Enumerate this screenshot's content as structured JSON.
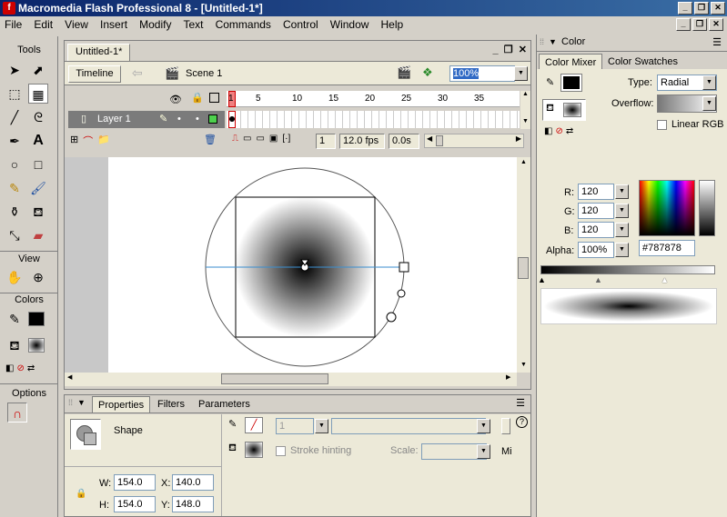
{
  "window": {
    "title": "Macromedia Flash Professional 8 - [Untitled-1*]"
  },
  "menu": [
    "File",
    "Edit",
    "View",
    "Insert",
    "Modify",
    "Text",
    "Commands",
    "Control",
    "Window",
    "Help"
  ],
  "tools": {
    "title": "Tools",
    "view_label": "View",
    "colors_label": "Colors",
    "options_label": "Options"
  },
  "document": {
    "tab": "Untitled-1*",
    "timeline_button": "Timeline",
    "scene": "Scene 1",
    "zoom": "100%"
  },
  "timeline": {
    "layer_name": "Layer 1",
    "frame_numbers": [
      "1",
      "5",
      "10",
      "15",
      "20",
      "25",
      "30",
      "35"
    ],
    "current_frame": "1",
    "fps": "12.0 fps",
    "time": "0.0s"
  },
  "properties": {
    "tabs": [
      "Properties",
      "Filters",
      "Parameters"
    ],
    "type": "Shape",
    "stroke_height": "1",
    "stroke_hinting": "Stroke hinting",
    "scale_label": "Scale:",
    "miter": "Mi",
    "w_label": "W:",
    "w": "154.0",
    "h_label": "H:",
    "h": "154.0",
    "x_label": "X:",
    "x": "140.0",
    "y_label": "Y:",
    "y": "148.0"
  },
  "color_panel": {
    "title": "Color",
    "tabs": [
      "Color Mixer",
      "Color Swatches"
    ],
    "type_label": "Type:",
    "type": "Radial",
    "overflow_label": "Overflow:",
    "linear_rgb": "Linear RGB",
    "r_label": "R:",
    "r": "120",
    "g_label": "G:",
    "g": "120",
    "b_label": "B:",
    "b": "120",
    "alpha_label": "Alpha:",
    "alpha": "100%",
    "hex": "#787878",
    "accent": "#316ac5"
  }
}
